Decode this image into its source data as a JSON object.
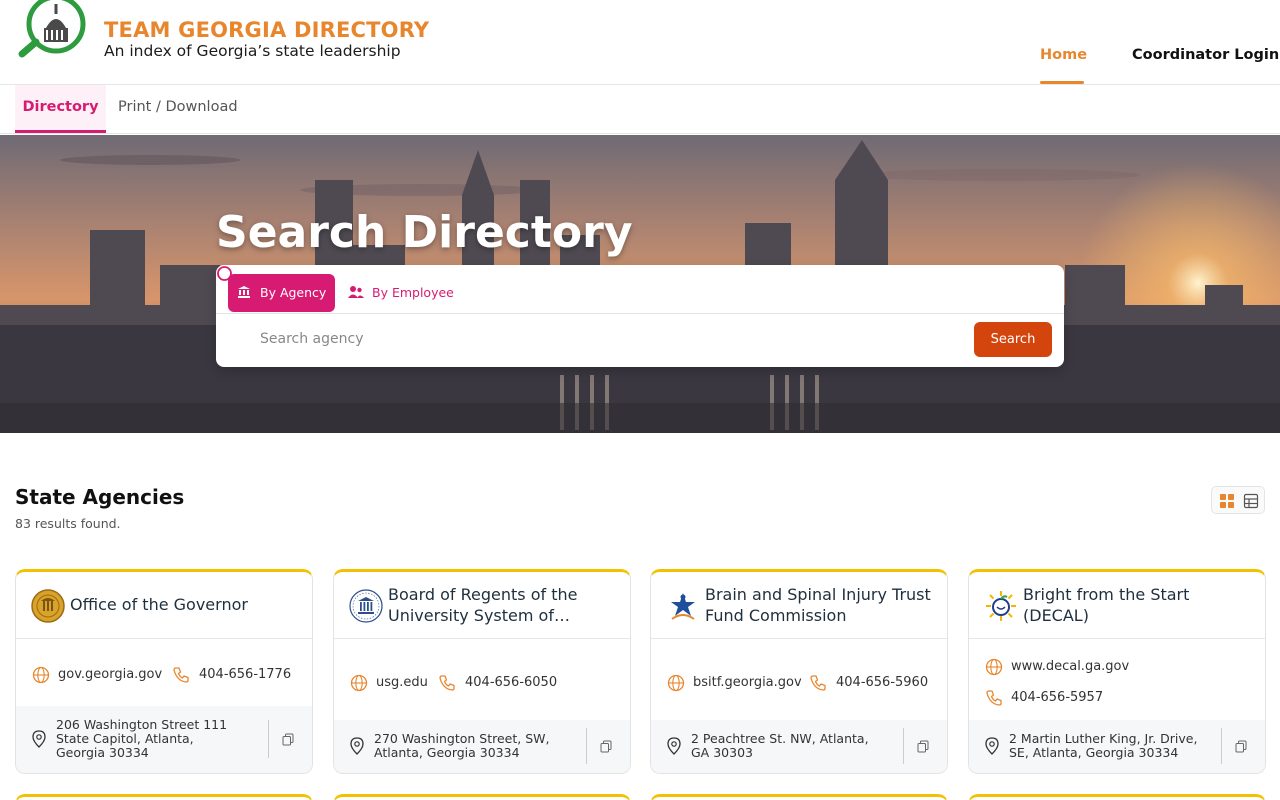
{
  "brand": {
    "title": "TEAM GEORGIA DIRECTORY",
    "subtitle": "An index of Georgia’s state leadership",
    "accent_color": "#e8862d"
  },
  "nav": {
    "home": "Home",
    "login": "Coordinator Login"
  },
  "subnav": {
    "directory": "Directory",
    "print": "Print / Download",
    "active_color": "#d81b72"
  },
  "hero": {
    "title": "Search Directory",
    "tab_agency": "By Agency",
    "tab_employee": "By Employee",
    "search_placeholder": "Search agency",
    "search_button": "Search",
    "button_color": "#d4450e"
  },
  "section": {
    "title": "State Agencies",
    "results": "83 results found."
  },
  "cards": [
    {
      "name": "Office of the Governor",
      "logo_icon": "georgia-seal-icon",
      "website": "gov.georgia.gov",
      "phone": "404-656-1776",
      "address": "206 Washington Street 111 State Capitol, Atlanta, Georgia 30334"
    },
    {
      "name": "Board of Regents of the University System of…",
      "logo_icon": "usg-columns-icon",
      "website": "usg.edu",
      "phone": "404-656-6050",
      "address": "270 Washington Street, SW, Atlanta, Georgia 30334"
    },
    {
      "name": "Brain and Spinal Injury Trust Fund Commission",
      "logo_icon": "star-figure-icon",
      "website": "bsitf.georgia.gov",
      "phone": "404-656-5960",
      "address": "2 Peachtree St. NW, Atlanta, GA 30303"
    },
    {
      "name": "Bright from the Start (DECAL)",
      "logo_icon": "sun-apple-icon",
      "website": "www.decal.ga.gov",
      "phone": "404-656-5957",
      "address": "2 Martin Luther King, Jr. Drive, SE, Atlanta, Georgia 30334"
    }
  ]
}
